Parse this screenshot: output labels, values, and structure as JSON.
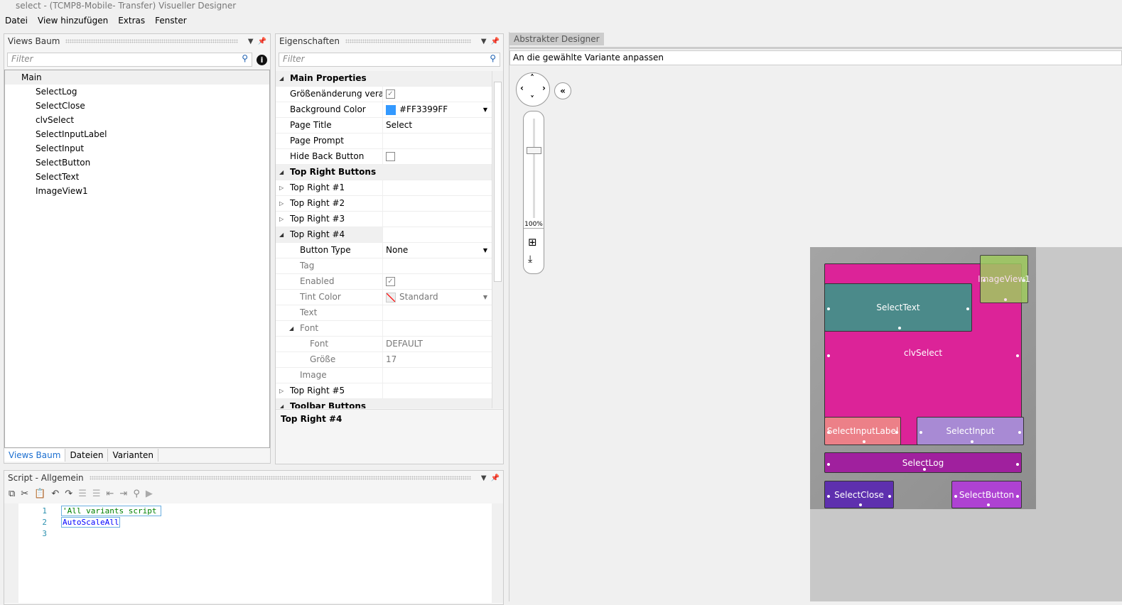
{
  "window": {
    "title": "select - (TCMP8-Mobile- Transfer) Visueller Designer"
  },
  "menu": [
    "Datei",
    "View hinzufügen",
    "Extras",
    "Fenster"
  ],
  "views_panel": {
    "title": "Views Baum",
    "filter_placeholder": "Filter",
    "root": "Main",
    "items": [
      "SelectLog",
      "SelectClose",
      "clvSelect",
      "SelectInputLabel",
      "SelectInput",
      "SelectButton",
      "SelectText",
      "ImageView1"
    ],
    "tabs": [
      "Views Baum",
      "Dateien",
      "Varianten"
    ]
  },
  "properties": {
    "title": "Eigenschaften",
    "filter_placeholder": "Filter",
    "rows": [
      {
        "label": "Main Properties",
        "type": "category",
        "expanded": true
      },
      {
        "label": "Größenänderung verar...",
        "checkbox": true,
        "checked": true
      },
      {
        "label": "Background Color",
        "value": "#FF3399FF",
        "swatch": "#3399ff",
        "dropdown": true
      },
      {
        "label": "Page Title",
        "value": "Select"
      },
      {
        "label": "Page Prompt",
        "value": ""
      },
      {
        "label": "Hide Back Button",
        "checkbox": true,
        "checked": false
      },
      {
        "label": "Top Right Buttons",
        "type": "category",
        "expanded": true
      },
      {
        "label": "Top Right #1",
        "collapsed": true
      },
      {
        "label": "Top Right #2",
        "collapsed": true
      },
      {
        "label": "Top Right #3",
        "collapsed": true
      },
      {
        "label": "Top Right #4",
        "expanded": true,
        "selected": true
      },
      {
        "label": "Button Type",
        "value": "None",
        "dropdown": true,
        "indent": 1
      },
      {
        "label": "Tag",
        "value": "",
        "indent": 1,
        "grey": true
      },
      {
        "label": "Enabled",
        "checkbox": true,
        "checked": true,
        "indent": 1,
        "grey": true
      },
      {
        "label": "Tint Color",
        "value": "Standard",
        "dropdown": true,
        "indent": 1,
        "grey": true,
        "swatch": "none"
      },
      {
        "label": "Text",
        "value": "",
        "indent": 1,
        "grey": true
      },
      {
        "label": "Font",
        "value": "",
        "indent": 1,
        "grey": true,
        "expanded": true
      },
      {
        "label": "Font",
        "value": "DEFAULT",
        "indent": 2,
        "grey": true
      },
      {
        "label": "Größe",
        "value": "17",
        "indent": 2,
        "grey": true
      },
      {
        "label": "Image",
        "value": "",
        "indent": 1,
        "grey": true
      },
      {
        "label": "Top Right #5",
        "collapsed": true
      },
      {
        "label": "Toolbar Buttons",
        "type": "category",
        "expanded": true
      }
    ],
    "description": "Top Right #4"
  },
  "script_panel": {
    "title": "Script - Allgemein",
    "lines": [
      {
        "num": "1",
        "text": "'All variants script",
        "color": "#008000"
      },
      {
        "num": "2",
        "text": "AutoScaleAll",
        "color": "#0000ff"
      },
      {
        "num": "3",
        "text": "",
        "color": "#000"
      }
    ]
  },
  "designer": {
    "tab": "Abstrakter Designer",
    "option": "An die gewählte Variante anpassen",
    "zoom": "100%",
    "views": [
      {
        "name": "clvSelect",
        "color": "#dc2398"
      },
      {
        "name": "SelectText",
        "color": "#4b8a8a"
      },
      {
        "name": "ImageView1",
        "color": "#9fcb5f"
      },
      {
        "name": "SelectInputLabel",
        "color": "#ec8088"
      },
      {
        "name": "SelectInput",
        "color": "#a88ad4"
      },
      {
        "name": "SelectLog",
        "color": "#a0209e"
      },
      {
        "name": "SelectClose",
        "color": "#5e30ae"
      },
      {
        "name": "SelectButton",
        "color": "#ae42d2"
      }
    ]
  }
}
